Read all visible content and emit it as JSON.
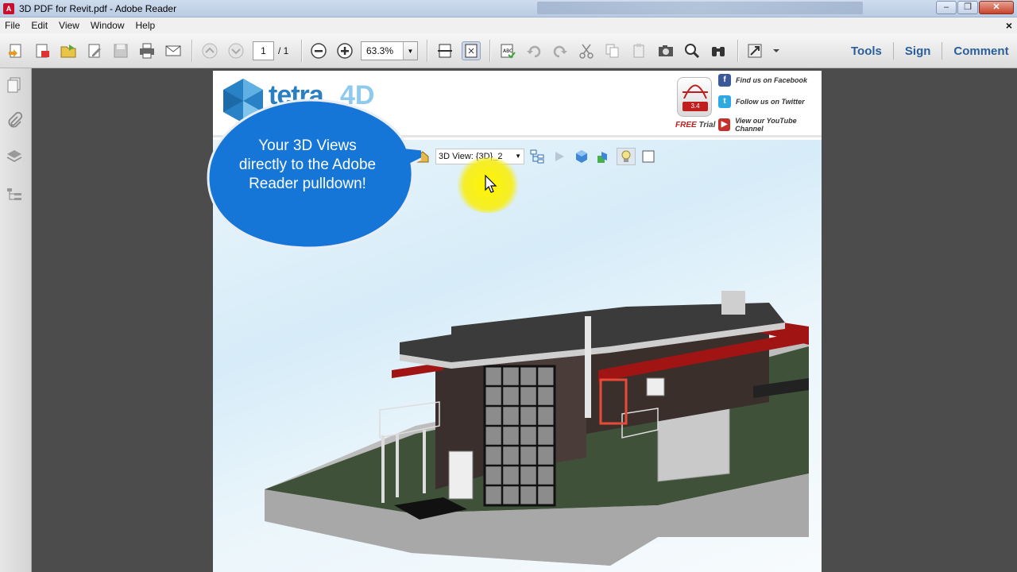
{
  "window": {
    "title": "3D PDF for Revit.pdf - Adobe Reader",
    "controls": [
      "minimize",
      "restore",
      "close"
    ]
  },
  "menu": {
    "items": [
      "File",
      "Edit",
      "View",
      "Window",
      "Help"
    ],
    "close_doc": "×"
  },
  "toolbar": {
    "page_current": "1",
    "page_total": "/ 1",
    "zoom": "63.3%",
    "right_links": [
      "Tools",
      "Sign",
      "Comment"
    ]
  },
  "document": {
    "header": {
      "logo_text": "tetra",
      "logo_suffix": "4D",
      "badge_number": "3.4",
      "free_trial": "FREE",
      "free_trial_suffix": "Trial",
      "social": [
        {
          "icon": "f",
          "label": "Find us on Facebook",
          "color": "#3b5998"
        },
        {
          "icon": "t",
          "label": "Follow us on Twitter",
          "color": "#2fa9e1"
        },
        {
          "icon": "▶",
          "label": "View our YouTube Channel",
          "color": "#c4302b"
        }
      ]
    },
    "scene_toolbar": {
      "view_select": "3D View: {3D}_2"
    },
    "callout": {
      "text": "Your 3D Views directly to the Adobe Reader pulldown!",
      "color": "#1576d8"
    }
  }
}
